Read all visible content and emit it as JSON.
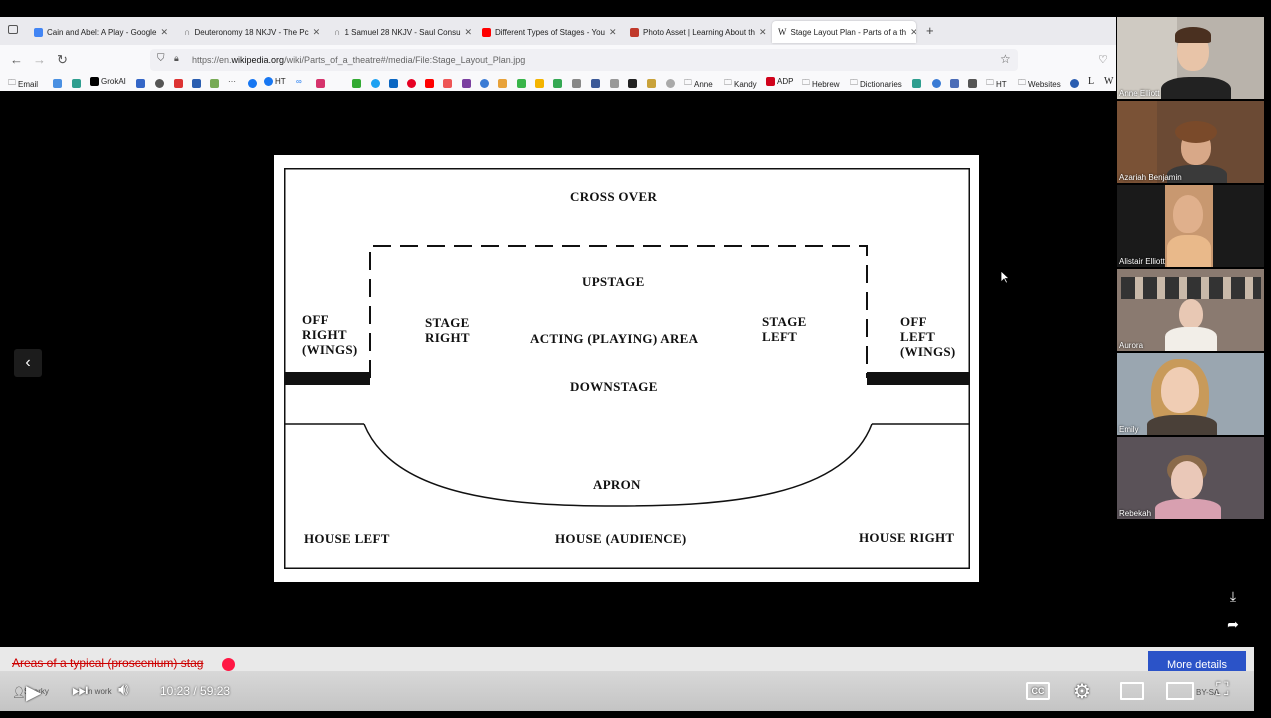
{
  "browser": {
    "tabs": [
      {
        "title": "Cain and Abel: A Play - Google",
        "color": "#4285f4"
      },
      {
        "title": "Deuteronomy 18 NKJV - The Pc",
        "color": "#888888"
      },
      {
        "title": "1 Samuel 28 NKJV - Saul Consu",
        "color": "#888888"
      },
      {
        "title": "Different Types of Stages - You",
        "color": "#ff0000"
      },
      {
        "title": "Photo Asset | Learning About th",
        "color": "#c0392b"
      },
      {
        "title": "Stage Layout Plan - Parts of a th",
        "color": "#333333"
      }
    ],
    "new_tab": "+",
    "url_prefix": "https://en.",
    "url_domain": "wikipedia.org",
    "url_path": "/wiki/Parts_of_a_theatre#/media/File:Stage_Layout_Plan.jpg",
    "bookmarks": {
      "email": "Email",
      "grokai": "GrokAI",
      "ht": "HT",
      "anne": "Anne",
      "kandy": "Kandy",
      "adp": "ADP",
      "hebrew": "Hebrew",
      "dictionaries": "Dictionaries",
      "ht2": "HT",
      "websites": "Websites",
      "l": "L"
    }
  },
  "diagram": {
    "cross_over": "CROSS OVER",
    "upstage": "UPSTAGE",
    "off_right": [
      "OFF",
      "RIGHT",
      "(WINGS)"
    ],
    "stage_right": [
      "STAGE",
      "RIGHT"
    ],
    "acting_area": "ACTING (PLAYING) AREA",
    "stage_left": [
      "STAGE",
      "LEFT"
    ],
    "off_left": [
      "OFF",
      "LEFT",
      "(WINGS)"
    ],
    "downstage": "DOWNSTAGE",
    "apron": "APRON",
    "house_left": "HOUSE LEFT",
    "house_audience": "HOUSE (AUDIENCE)",
    "house_right": "HOUSE RIGHT"
  },
  "participants": [
    {
      "name": "Anne Elliott",
      "bg": "#b9b3ab",
      "skin": "#e8c4a8",
      "shirt": "#222222"
    },
    {
      "name": "Azariah Benjamin",
      "bg": "#6b4a34",
      "skin": "#d8a888",
      "shirt": "#3a3a3a"
    },
    {
      "name": "Alistair Elliott",
      "bg": "#1a1a1a",
      "skin": "#e0b08c",
      "shirt": "#e9b98a"
    },
    {
      "name": "Aurora",
      "bg": "#8a7a70",
      "skin": "#e8c8b4",
      "shirt": "#f2eee8"
    },
    {
      "name": "Emily",
      "bg": "#9aa6b0",
      "skin": "#f0cdb4",
      "shirt": "#4a4038"
    },
    {
      "name": "Rebekah",
      "bg": "#5a5258",
      "skin": "#eac8b8",
      "shirt": "#d8a0b0"
    }
  ],
  "player": {
    "caption": "Areas of a typical (proscenium) stag",
    "more_details": "More details",
    "time": "10:23 / 59:23",
    "channel": "Sparky",
    "work_text": "n work",
    "license_text": "BY-SA",
    "progress": 0.17
  }
}
